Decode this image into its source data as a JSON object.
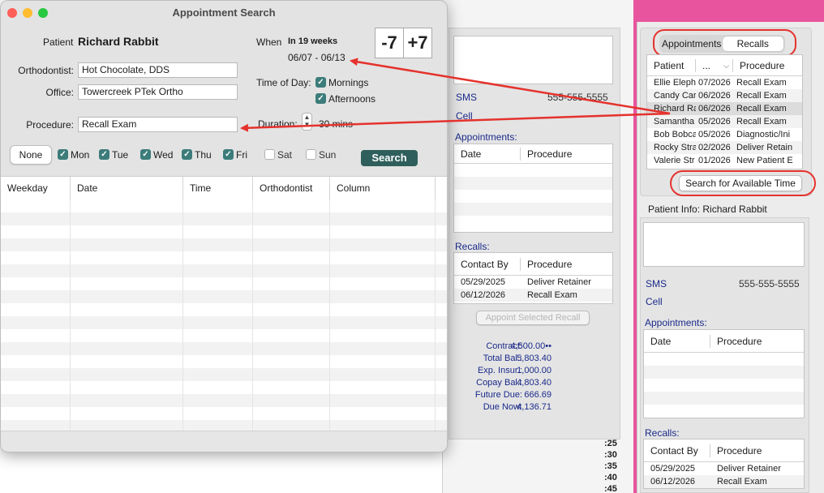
{
  "main": {
    "title": "Appointment Search",
    "patient_label": "Patient",
    "patient_name": "Richard Rabbit",
    "orthodontist_label": "Orthodontist:",
    "orthodontist_value": "Hot Chocolate, DDS",
    "office_label": "Office:",
    "office_value": "Towercreek PTek Ortho",
    "procedure_label": "Procedure:",
    "procedure_value": "Recall Exam",
    "when_label": "When",
    "when_value": "In 19 weeks",
    "date_range": "06/07 - 06/13",
    "minus_label": "-7",
    "plus_label": "+7",
    "time_of_day_label": "Time of Day:",
    "mornings_label": "Mornings",
    "afternoons_label": "Afternoons",
    "duration_label": "Duration:",
    "duration_value": "30 mins",
    "none_button": "None",
    "days": [
      {
        "label": "Mon",
        "checked": true
      },
      {
        "label": "Tue",
        "checked": true
      },
      {
        "label": "Wed",
        "checked": true
      },
      {
        "label": "Thu",
        "checked": true
      },
      {
        "label": "Fri",
        "checked": true
      },
      {
        "label": "Sat",
        "checked": false
      },
      {
        "label": "Sun",
        "checked": false
      }
    ],
    "search_button": "Search",
    "columns": [
      "Weekday",
      "Date",
      "Time",
      "Orthodontist",
      "Column"
    ]
  },
  "middle": {
    "sms_label": "SMS",
    "sms_phone": "555-555-5555",
    "cell_label": "Cell",
    "appointments_label": "Appointments:",
    "appt_columns": [
      "Date",
      "Procedure"
    ],
    "recalls_label": "Recalls:",
    "recall_columns": [
      "Contact By",
      "Procedure"
    ],
    "recalls": [
      {
        "date": "05/29/2025",
        "procedure": "Deliver Retainer"
      },
      {
        "date": "06/12/2026",
        "procedure": "Recall Exam"
      }
    ],
    "appoint_button": "Appoint Selected Recall",
    "financials": [
      {
        "label": "Contract:",
        "value": "4,500.00••"
      },
      {
        "label": "Total Bal.:",
        "value": "5,803.40"
      },
      {
        "label": "Exp. Insur.:",
        "value": "1,000.00"
      },
      {
        "label": "Copay Bal.:",
        "value": "4,803.40"
      },
      {
        "label": "Future Due:",
        "value": "666.69"
      },
      {
        "label": "Due Now:",
        "value": "4,136.71"
      }
    ],
    "times": [
      ":25",
      ":30",
      ":35",
      ":40",
      ":45"
    ]
  },
  "right": {
    "tab_appointments": "Appointments",
    "tab_recalls": "Recalls",
    "list_columns": [
      "Patient",
      "...",
      "Procedure"
    ],
    "list_rows": [
      {
        "patient": "Ellie Eleph",
        "date": "07/2026",
        "procedure": "Recall Exam"
      },
      {
        "patient": "Candy Car",
        "date": "06/2026",
        "procedure": "Recall Exam"
      },
      {
        "patient": "Richard Ra",
        "date": "06/2026",
        "procedure": "Recall Exam"
      },
      {
        "patient": "Samantha",
        "date": "05/2026",
        "procedure": "Recall Exam"
      },
      {
        "patient": "Bob Bobca",
        "date": "05/2026",
        "procedure": "Diagnostic/Ini"
      },
      {
        "patient": "Rocky Stra",
        "date": "02/2026",
        "procedure": "Deliver Retain"
      },
      {
        "patient": "Valerie Str",
        "date": "01/2026",
        "procedure": "New Patient E"
      }
    ],
    "search_available_button": "Search for Available Time",
    "patient_info_label": "Patient Info: Richard Rabbit",
    "sms_label": "SMS",
    "sms_phone": "555-555-5555",
    "cell_label": "Cell",
    "appointments_label": "Appointments:",
    "appt_columns": [
      "Date",
      "Procedure"
    ],
    "recalls_label": "Recalls:",
    "recall_columns": [
      "Contact By",
      "Procedure"
    ],
    "recalls": [
      {
        "date": "05/29/2025",
        "procedure": "Deliver Retainer"
      },
      {
        "date": "06/12/2026",
        "procedure": "Recall Exam"
      }
    ]
  },
  "colors": {
    "accent_teal": "#3c7c7a",
    "annotation_red": "#e5322d",
    "link_blue": "#1a2a8a",
    "desktop_pink": "#e8559e"
  }
}
